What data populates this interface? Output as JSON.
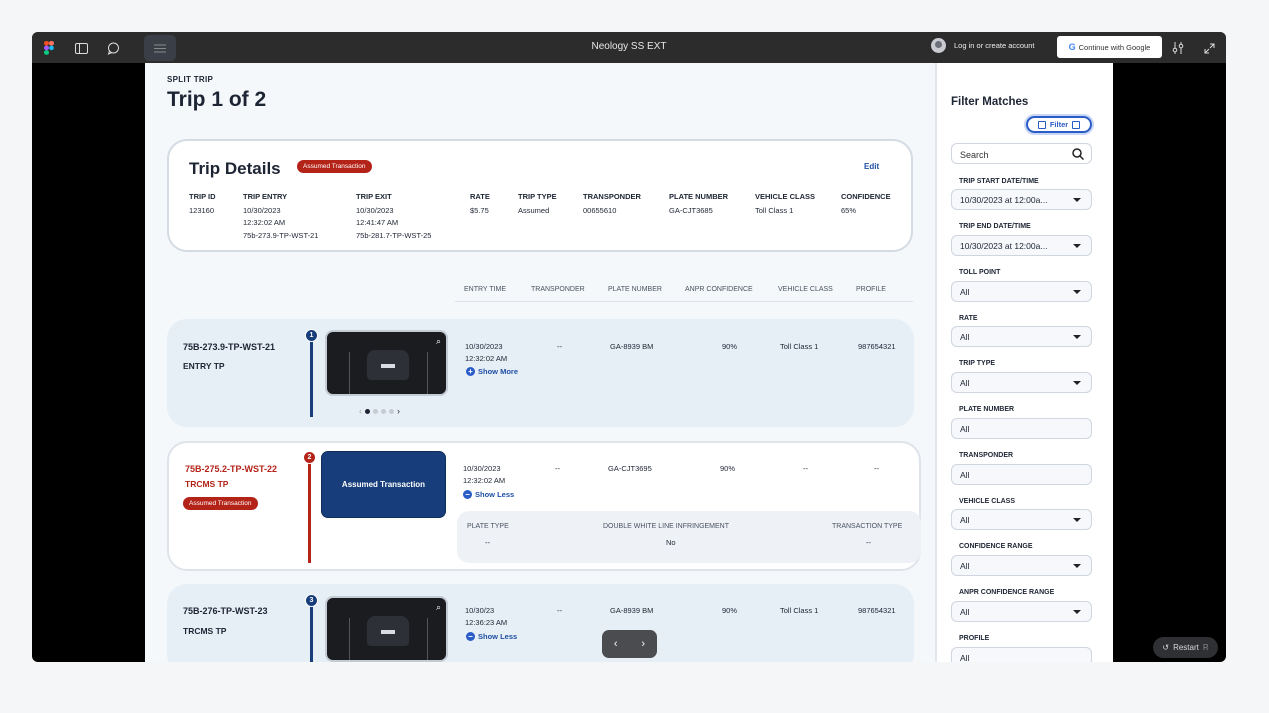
{
  "window": {
    "title": "Neology SS EXT",
    "login_text": "Log in or create account",
    "google_label": "Continue with Google"
  },
  "page": {
    "split_label": "SPLIT TRIP",
    "title": "Trip 1 of 2"
  },
  "details": {
    "heading": "Trip Details",
    "badge": "Assumed Transaction",
    "edit": "Edit",
    "columns": [
      {
        "header": "TRIP ID",
        "lines": [
          "123160"
        ]
      },
      {
        "header": "TRIP ENTRY",
        "lines": [
          "10/30/2023",
          "12:32:02 AM",
          "75b-273.9-TP-WST-21"
        ]
      },
      {
        "header": "TRIP EXIT",
        "lines": [
          "10/30/2023",
          "12:41:47 AM",
          "75b-281.7-TP-WST-25"
        ]
      },
      {
        "header": "RATE",
        "lines": [
          "$5.75"
        ]
      },
      {
        "header": "TRIP TYPE",
        "lines": [
          "Assumed"
        ]
      },
      {
        "header": "TRANSPONDER",
        "lines": [
          "00655610"
        ]
      },
      {
        "header": "PLATE NUMBER",
        "lines": [
          "GA-CJT3685"
        ]
      },
      {
        "header": "VEHICLE CLASS",
        "lines": [
          "Toll Class 1"
        ]
      },
      {
        "header": "CONFIDENCE",
        "lines": [
          "65%"
        ]
      }
    ]
  },
  "table_headers": [
    "ENTRY TIME",
    "TRANSPONDER",
    "PLATE NUMBER",
    "ANPR CONFIDENCE",
    "VEHICLE CLASS",
    "PROFILE"
  ],
  "rows": [
    {
      "number": "1",
      "name": "75B-273.9-TP-WST-21",
      "type": "ENTRY TP",
      "date": "10/30/2023",
      "time": "12:32:02 AM",
      "transponder": "--",
      "plate": "GA-8939 BM",
      "anpr": "90%",
      "vclass": "Toll Class 1",
      "profile": "987654321",
      "link": "Show More",
      "link_icon": "+"
    },
    {
      "number": "2",
      "name": "75B-275.2-TP-WST-22",
      "type": "TRCMS TP",
      "badge": "Assumed Transaction",
      "box": "Assumed Transaction",
      "date": "10/30/2023",
      "time": "12:32:02 AM",
      "transponder": "--",
      "plate": "GA-CJT3695",
      "anpr": "90%",
      "vclass": "--",
      "profile": "--",
      "link": "Show Less",
      "link_icon": "−",
      "extra": [
        {
          "header": "PLATE TYPE",
          "value": "--"
        },
        {
          "header": "DOUBLE WHITE LINE INFRINGEMENT",
          "value": "No"
        },
        {
          "header": "TRANSACTION TYPE",
          "value": "--"
        }
      ]
    },
    {
      "number": "3",
      "name": "75B-276-TP-WST-23",
      "type": "TRCMS TP",
      "date": "10/30/23",
      "time": "12:36:23 AM",
      "transponder": "--",
      "plate": "GA-8939 BM",
      "anpr": "90%",
      "vclass": "Toll Class 1",
      "profile": "987654321",
      "link": "Show Less",
      "link_icon": "−"
    }
  ],
  "filters": {
    "heading": "Filter Matches",
    "filter_button": "Filter",
    "search_placeholder": "Search",
    "fields": [
      {
        "label": "TRIP START DATE/TIME",
        "value": "10/30/2023 at 12:00a...",
        "dropdown": true
      },
      {
        "label": "TRIP END DATE/TIME",
        "value": "10/30/2023 at 12:00a...",
        "dropdown": true
      },
      {
        "label": "TOLL POINT",
        "value": "All",
        "dropdown": true
      },
      {
        "label": "RATE",
        "value": "All",
        "dropdown": true
      },
      {
        "label": "TRIP TYPE",
        "value": "All",
        "dropdown": true
      },
      {
        "label": "PLATE NUMBER",
        "value": "All",
        "dropdown": false
      },
      {
        "label": "TRANSPONDER",
        "value": "All",
        "dropdown": false
      },
      {
        "label": "VEHICLE CLASS",
        "value": "All",
        "dropdown": true
      },
      {
        "label": "CONFIDENCE RANGE",
        "value": "All",
        "dropdown": true
      },
      {
        "label": "ANPR CONFIDENCE RANGE",
        "value": "All",
        "dropdown": true
      },
      {
        "label": "PROFILE",
        "value": "All",
        "dropdown": false
      }
    ]
  },
  "overlay": {
    "restart": "Restart",
    "restart_key": "R"
  },
  "colors": {
    "accent": "#1e4fa3",
    "danger": "#b42318",
    "navy": "#173e7a"
  }
}
